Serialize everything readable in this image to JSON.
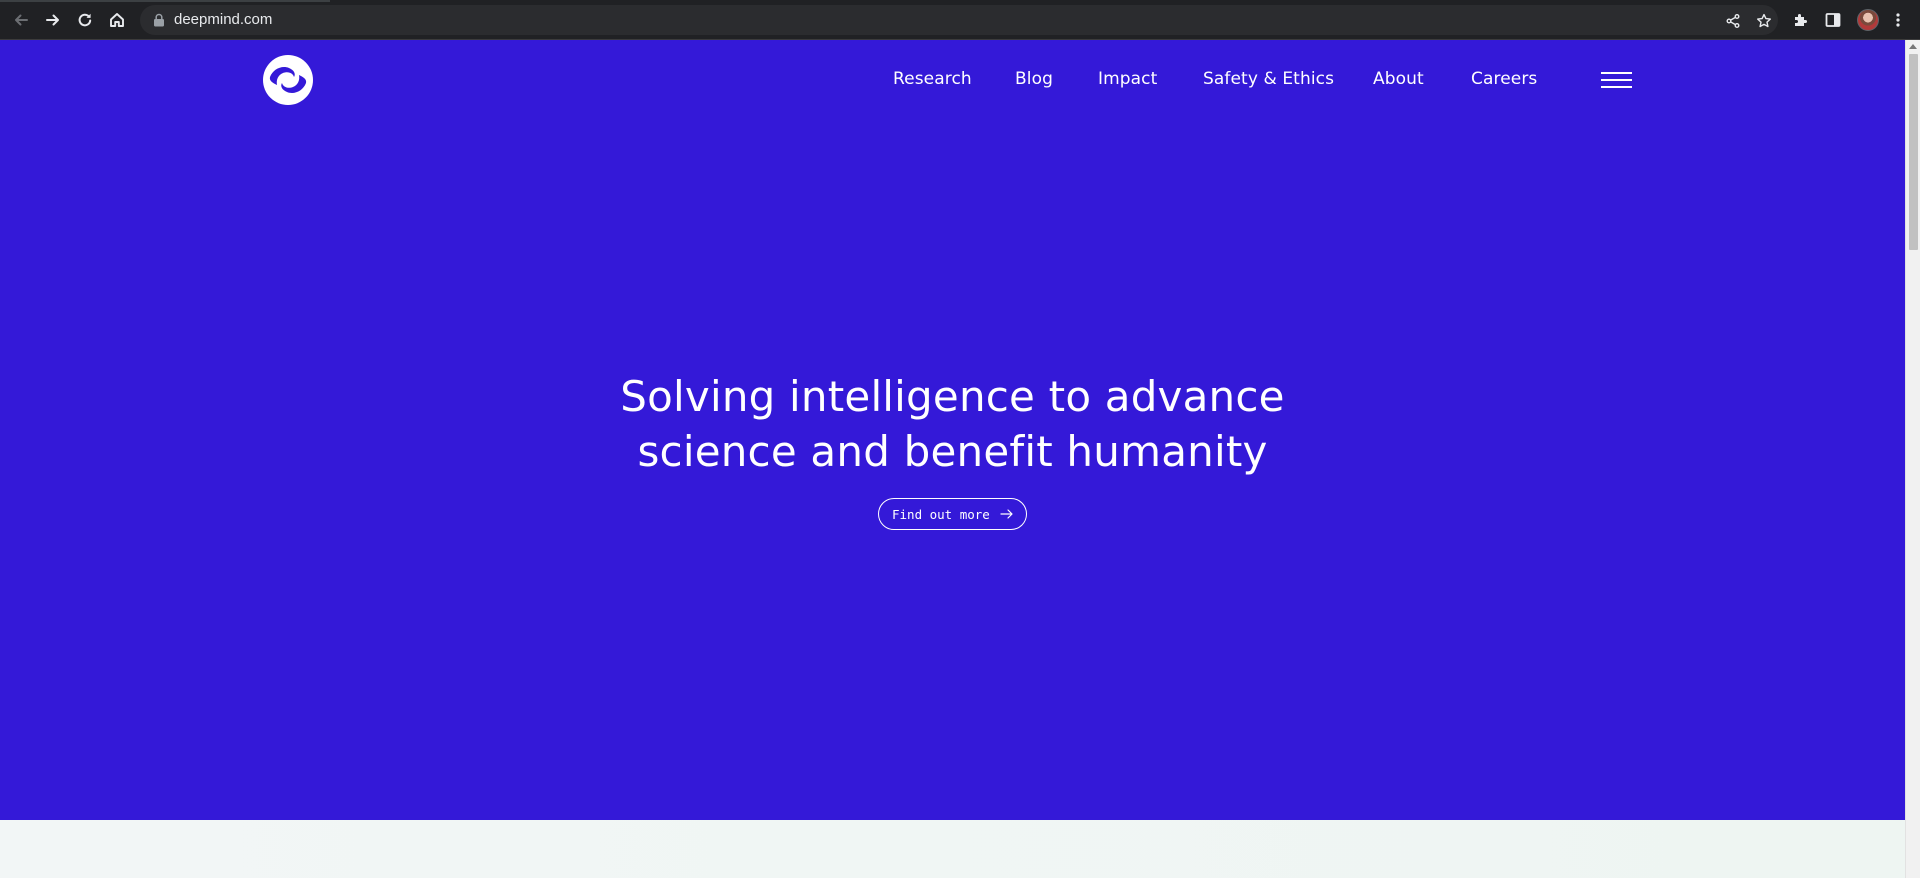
{
  "browser": {
    "url": "deepmind.com",
    "icons": {
      "back": "back-arrow-icon",
      "forward": "forward-arrow-icon",
      "reload": "reload-icon",
      "home": "home-icon",
      "lock": "lock-icon",
      "share": "share-icon",
      "bookmark": "star-icon",
      "extensions": "puzzle-icon",
      "side_panel": "side-panel-icon",
      "profile": "profile-avatar",
      "menu": "kebab-menu-icon"
    },
    "colors": {
      "chrome_bg": "#202124",
      "omnibox_bg": "#2b2c2f",
      "text": "#e8eaed"
    }
  },
  "site": {
    "logo": "deepmind-logo",
    "nav": {
      "items": [
        {
          "label": "Research"
        },
        {
          "label": "Blog"
        },
        {
          "label": "Impact"
        },
        {
          "label": "Safety & Ethics"
        },
        {
          "label": "About"
        },
        {
          "label": "Careers"
        }
      ],
      "menu_icon": "hamburger-menu-icon"
    },
    "hero": {
      "headline_line1": "Solving intelligence to advance",
      "headline_line2": "science and benefit humanity",
      "cta_label": "Find out more",
      "cta_icon": "arrow-right-icon"
    },
    "colors": {
      "hero_bg": "#3419d8",
      "text": "#ffffff",
      "below_bg": "#f0f6f4"
    }
  }
}
